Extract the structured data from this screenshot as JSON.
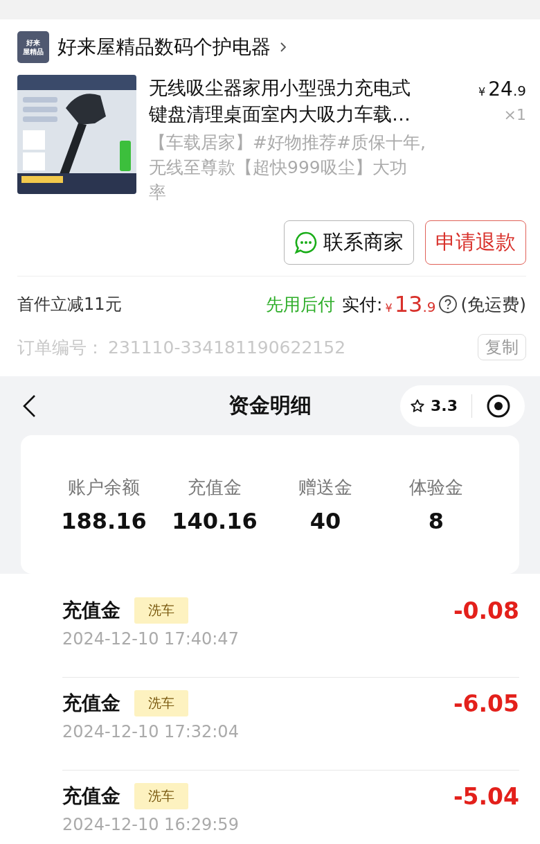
{
  "order": {
    "shop": {
      "logo_lines": [
        "好来",
        "屋精品"
      ],
      "name": "好来屋精品数码个护电器"
    },
    "product": {
      "kind": "picture",
      "title_lines": [
        "无线吸尘器家用小型强力充电式",
        "键盘清理桌面室内大吸力车载…"
      ],
      "currency": "¥",
      "price_int": "24",
      "price_dec": ".9",
      "quantity": "×1",
      "subtitle_lines": [
        "【车载居家】#好物推荐#质保十年,",
        "无线至尊款【超快999吸尘】大功",
        "率"
      ]
    },
    "buttons": [
      {
        "label": "联系商家",
        "kind": "contact"
      },
      {
        "label": "申请退款",
        "kind": "refund"
      }
    ],
    "discount": "首件立减11元",
    "pay_later": "先用后付",
    "paid_label": "实付:",
    "paid_currency": "¥",
    "paid_int": "13",
    "paid_dec": ".9",
    "shipping": "(免运费)",
    "order_number_label": "订单编号：",
    "order_number": "231110-334181190622152",
    "copy_button": "复制"
  },
  "funds": {
    "title": "资金明细",
    "rating": "3.3",
    "balances": [
      {
        "label": "账户余额",
        "value": "188.16"
      },
      {
        "label": "充值金",
        "value": "140.16"
      },
      {
        "label": "赠送金",
        "value": "40"
      },
      {
        "label": "体验金",
        "value": "8"
      }
    ],
    "records": [
      {
        "title": "充值金",
        "tag": "洗车",
        "time": "2024-12-10 17:40:47",
        "amount": "-0.08"
      },
      {
        "title": "充值金",
        "tag": "洗车",
        "time": "2024-12-10 17:32:04",
        "amount": "-6.05"
      },
      {
        "title": "充值金",
        "tag": "洗车",
        "time": "2024-12-10 16:29:59",
        "amount": "-5.04"
      }
    ]
  }
}
